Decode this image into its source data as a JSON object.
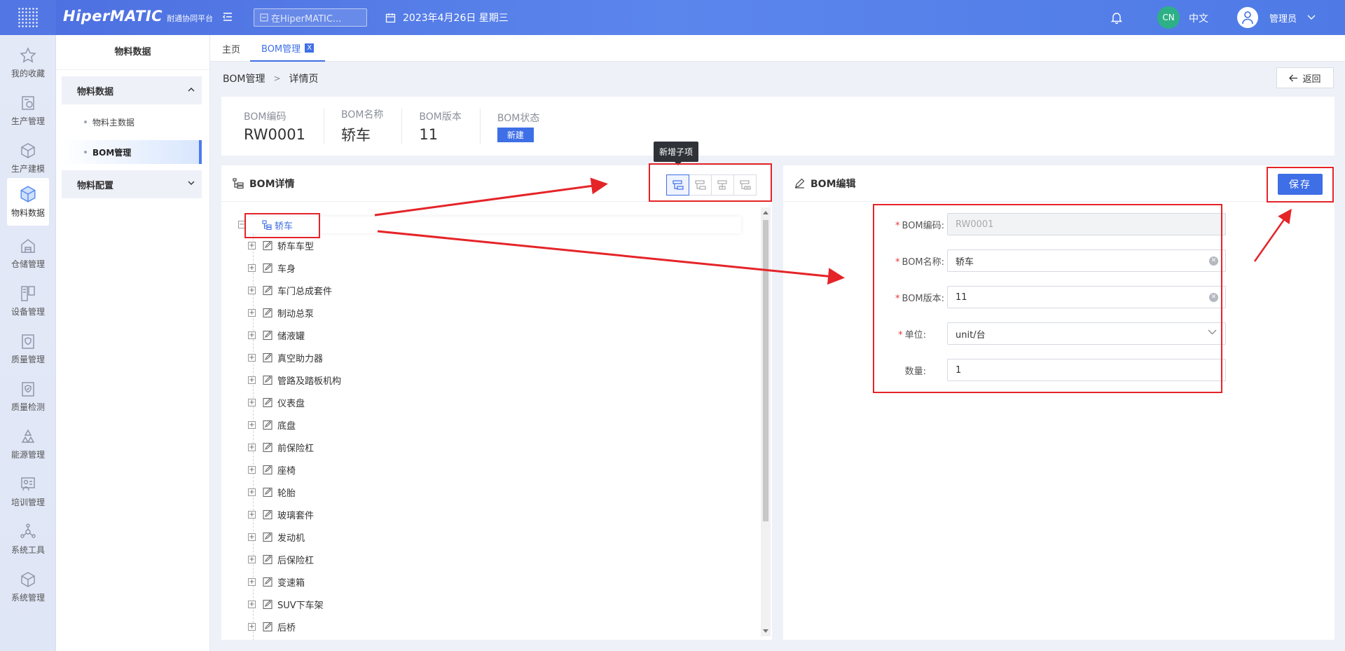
{
  "header": {
    "logo": "HiperMATIC",
    "logo_sub": "耐通协同平台",
    "search_placeholder": "在HiperMATIC...",
    "date": "2023年4月26日 星期三",
    "lang_badge": "CN",
    "lang_label": "中文",
    "user_name": "管理员"
  },
  "nav": {
    "items": [
      {
        "label": "我的收藏",
        "icon": "star-icon"
      },
      {
        "label": "生产管理",
        "icon": "production-icon"
      },
      {
        "label": "生产建模",
        "icon": "cube-icon"
      },
      {
        "label": "物料数据",
        "icon": "material-cube-icon"
      },
      {
        "label": "仓储管理",
        "icon": "warehouse-icon"
      },
      {
        "label": "设备管理",
        "icon": "device-icon"
      },
      {
        "label": "质量管理",
        "icon": "quality-shield-icon"
      },
      {
        "label": "质量检测",
        "icon": "quality-check-icon"
      },
      {
        "label": "能源管理",
        "icon": "recycle-icon"
      },
      {
        "label": "培训管理",
        "icon": "training-icon"
      },
      {
        "label": "系统工具",
        "icon": "network-icon"
      },
      {
        "label": "系统管理",
        "icon": "system-cube-icon"
      }
    ]
  },
  "submenu": {
    "title": "物料数据",
    "group1": "物料数据",
    "item1": "物料主数据",
    "item2": "BOM管理",
    "group2": "物料配置"
  },
  "tabs": {
    "home": "主页",
    "bom": "BOM管理",
    "close": "X"
  },
  "breadcrumb": {
    "parent": "BOM管理",
    "sep": ">",
    "current": "详情页"
  },
  "return_label": "返回",
  "info": {
    "code_label": "BOM编码",
    "code_value": "RW0001",
    "name_label": "BOM名称",
    "name_value": "轿车",
    "version_label": "BOM版本",
    "version_value": "11",
    "status_label": "BOM状态",
    "status_value": "新建"
  },
  "detail_panel": {
    "title": "BOM详情",
    "tooltip": "新增子项",
    "root": "轿车",
    "nodes": [
      "轿车车型",
      "车身",
      "车门总成套件",
      "制动总泵",
      "储液罐",
      "真空助力器",
      "管路及踏板机构",
      "仪表盘",
      "底盘",
      "前保险杠",
      "座椅",
      "轮胎",
      "玻璃套件",
      "发动机",
      "后保险杠",
      "变速箱",
      "SUV下车架",
      "后桥"
    ]
  },
  "edit_panel": {
    "title": "BOM编辑",
    "save": "保存",
    "fields": {
      "code_label": "BOM编码:",
      "code_value": "RW0001",
      "name_label": "BOM名称:",
      "name_value": "轿车",
      "version_label": "BOM版本:",
      "version_value": "11",
      "unit_label": "单位:",
      "unit_value": "unit/台",
      "qty_label": "数量:",
      "qty_value": "1"
    }
  },
  "colors": {
    "primary": "#3f6fe6",
    "annotation": "#e52428"
  }
}
